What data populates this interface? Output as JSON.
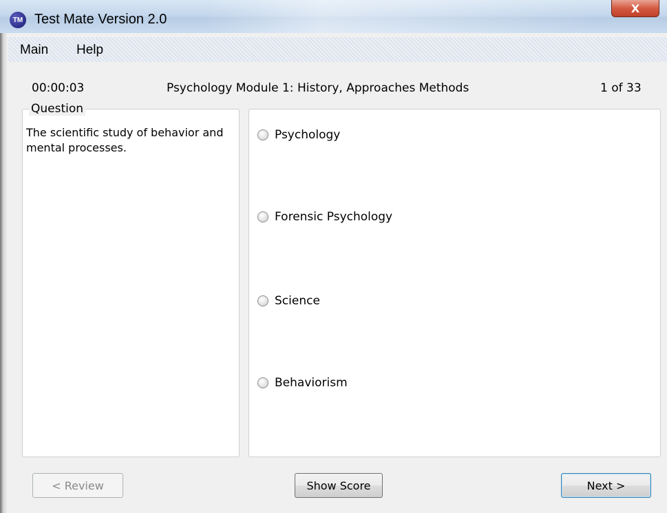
{
  "window": {
    "title": "Test Mate Version 2.0",
    "app_icon_text": "TM",
    "close_glyph": "X"
  },
  "menu": {
    "items": [
      "Main",
      "Help"
    ]
  },
  "header": {
    "timer": "00:00:03",
    "module_title": "Psychology Module 1: History, Approaches  Methods",
    "progress": "1 of 33"
  },
  "question": {
    "legend": "Question",
    "text": "The scientific study of behavior and mental processes."
  },
  "choices": [
    {
      "label": "Psychology",
      "selected": false
    },
    {
      "label": "Forensic Psychology",
      "selected": false
    },
    {
      "label": "Science",
      "selected": false
    },
    {
      "label": "Behaviorism",
      "selected": false
    }
  ],
  "buttons": {
    "review": {
      "label": "< Review",
      "enabled": false
    },
    "show_score": {
      "label": "Show Score",
      "enabled": true
    },
    "next": {
      "label": "Next >",
      "enabled": true,
      "default": true
    }
  }
}
